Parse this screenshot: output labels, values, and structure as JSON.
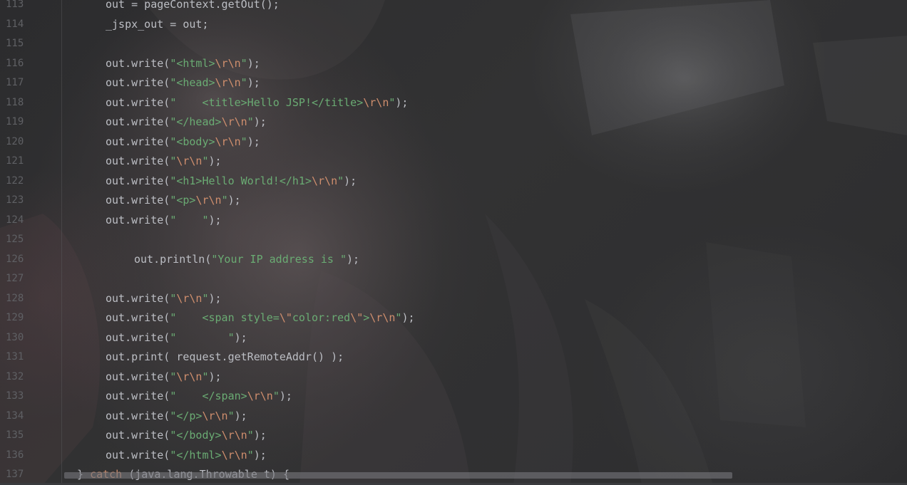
{
  "editor": {
    "theme": {
      "line_number_color": "#5f6064",
      "text_color": "#bcbec4",
      "string_color": "#6aab73",
      "escape_color": "#cf8e6d",
      "keyword_color": "#cf8e6d"
    },
    "lines": [
      {
        "number": "113",
        "indent": 3,
        "tokens": [
          {
            "t": "p",
            "v": "out = pageContext.getOut();"
          }
        ]
      },
      {
        "number": "114",
        "indent": 3,
        "tokens": [
          {
            "t": "p",
            "v": "_jspx_out = out;"
          }
        ]
      },
      {
        "number": "115",
        "indent": 3,
        "tokens": []
      },
      {
        "number": "116",
        "indent": 3,
        "tokens": [
          {
            "t": "p",
            "v": "out.write("
          },
          {
            "t": "s",
            "v": "\"<html>"
          },
          {
            "t": "e",
            "v": "\\r\\n"
          },
          {
            "t": "s",
            "v": "\""
          },
          {
            "t": "p",
            "v": ");"
          }
        ]
      },
      {
        "number": "117",
        "indent": 3,
        "tokens": [
          {
            "t": "p",
            "v": "out.write("
          },
          {
            "t": "s",
            "v": "\"<head>"
          },
          {
            "t": "e",
            "v": "\\r\\n"
          },
          {
            "t": "s",
            "v": "\""
          },
          {
            "t": "p",
            "v": ");"
          }
        ]
      },
      {
        "number": "118",
        "indent": 3,
        "tokens": [
          {
            "t": "p",
            "v": "out.write("
          },
          {
            "t": "s",
            "v": "\"    <title>Hello JSP!</title>"
          },
          {
            "t": "e",
            "v": "\\r\\n"
          },
          {
            "t": "s",
            "v": "\""
          },
          {
            "t": "p",
            "v": ");"
          }
        ]
      },
      {
        "number": "119",
        "indent": 3,
        "tokens": [
          {
            "t": "p",
            "v": "out.write("
          },
          {
            "t": "s",
            "v": "\"</head>"
          },
          {
            "t": "e",
            "v": "\\r\\n"
          },
          {
            "t": "s",
            "v": "\""
          },
          {
            "t": "p",
            "v": ");"
          }
        ]
      },
      {
        "number": "120",
        "indent": 3,
        "tokens": [
          {
            "t": "p",
            "v": "out.write("
          },
          {
            "t": "s",
            "v": "\"<body>"
          },
          {
            "t": "e",
            "v": "\\r\\n"
          },
          {
            "t": "s",
            "v": "\""
          },
          {
            "t": "p",
            "v": ");"
          }
        ]
      },
      {
        "number": "121",
        "indent": 3,
        "tokens": [
          {
            "t": "p",
            "v": "out.write("
          },
          {
            "t": "s",
            "v": "\""
          },
          {
            "t": "e",
            "v": "\\r\\n"
          },
          {
            "t": "s",
            "v": "\""
          },
          {
            "t": "p",
            "v": ");"
          }
        ]
      },
      {
        "number": "122",
        "indent": 3,
        "tokens": [
          {
            "t": "p",
            "v": "out.write("
          },
          {
            "t": "s",
            "v": "\"<h1>Hello World!</h1>"
          },
          {
            "t": "e",
            "v": "\\r\\n"
          },
          {
            "t": "s",
            "v": "\""
          },
          {
            "t": "p",
            "v": ");"
          }
        ]
      },
      {
        "number": "123",
        "indent": 3,
        "tokens": [
          {
            "t": "p",
            "v": "out.write("
          },
          {
            "t": "s",
            "v": "\"<p>"
          },
          {
            "t": "e",
            "v": "\\r\\n"
          },
          {
            "t": "s",
            "v": "\""
          },
          {
            "t": "p",
            "v": ");"
          }
        ]
      },
      {
        "number": "124",
        "indent": 3,
        "tokens": [
          {
            "t": "p",
            "v": "out.write("
          },
          {
            "t": "s",
            "v": "\"    \""
          },
          {
            "t": "p",
            "v": ");"
          }
        ]
      },
      {
        "number": "125",
        "indent": 3,
        "tokens": []
      },
      {
        "number": "126",
        "indent": 4,
        "tokens": [
          {
            "t": "p",
            "v": "out.println("
          },
          {
            "t": "s",
            "v": "\"Your IP address is \""
          },
          {
            "t": "p",
            "v": ");"
          }
        ]
      },
      {
        "number": "127",
        "indent": 3,
        "tokens": []
      },
      {
        "number": "128",
        "indent": 3,
        "tokens": [
          {
            "t": "p",
            "v": "out.write("
          },
          {
            "t": "s",
            "v": "\""
          },
          {
            "t": "e",
            "v": "\\r\\n"
          },
          {
            "t": "s",
            "v": "\""
          },
          {
            "t": "p",
            "v": ");"
          }
        ]
      },
      {
        "number": "129",
        "indent": 3,
        "tokens": [
          {
            "t": "p",
            "v": "out.write("
          },
          {
            "t": "s",
            "v": "\"    <span style="
          },
          {
            "t": "e",
            "v": "\\\""
          },
          {
            "t": "s",
            "v": "color:red"
          },
          {
            "t": "e",
            "v": "\\\""
          },
          {
            "t": "s",
            "v": ">"
          },
          {
            "t": "e",
            "v": "\\r\\n"
          },
          {
            "t": "s",
            "v": "\""
          },
          {
            "t": "p",
            "v": ");"
          }
        ]
      },
      {
        "number": "130",
        "indent": 3,
        "tokens": [
          {
            "t": "p",
            "v": "out.write("
          },
          {
            "t": "s",
            "v": "\"        \""
          },
          {
            "t": "p",
            "v": ");"
          }
        ]
      },
      {
        "number": "131",
        "indent": 3,
        "tokens": [
          {
            "t": "p",
            "v": "out.print( request.getRemoteAddr() );"
          }
        ]
      },
      {
        "number": "132",
        "indent": 3,
        "tokens": [
          {
            "t": "p",
            "v": "out.write("
          },
          {
            "t": "s",
            "v": "\""
          },
          {
            "t": "e",
            "v": "\\r\\n"
          },
          {
            "t": "s",
            "v": "\""
          },
          {
            "t": "p",
            "v": ");"
          }
        ]
      },
      {
        "number": "133",
        "indent": 3,
        "tokens": [
          {
            "t": "p",
            "v": "out.write("
          },
          {
            "t": "s",
            "v": "\"    </span>"
          },
          {
            "t": "e",
            "v": "\\r\\n"
          },
          {
            "t": "s",
            "v": "\""
          },
          {
            "t": "p",
            "v": ");"
          }
        ]
      },
      {
        "number": "134",
        "indent": 3,
        "tokens": [
          {
            "t": "p",
            "v": "out.write("
          },
          {
            "t": "s",
            "v": "\"</p>"
          },
          {
            "t": "e",
            "v": "\\r\\n"
          },
          {
            "t": "s",
            "v": "\""
          },
          {
            "t": "p",
            "v": ");"
          }
        ]
      },
      {
        "number": "135",
        "indent": 3,
        "tokens": [
          {
            "t": "p",
            "v": "out.write("
          },
          {
            "t": "s",
            "v": "\"</body>"
          },
          {
            "t": "e",
            "v": "\\r\\n"
          },
          {
            "t": "s",
            "v": "\""
          },
          {
            "t": "p",
            "v": ");"
          }
        ]
      },
      {
        "number": "136",
        "indent": 3,
        "tokens": [
          {
            "t": "p",
            "v": "out.write("
          },
          {
            "t": "s",
            "v": "\"</html>"
          },
          {
            "t": "e",
            "v": "\\r\\n"
          },
          {
            "t": "s",
            "v": "\""
          },
          {
            "t": "p",
            "v": ");"
          }
        ]
      },
      {
        "number": "137",
        "indent": 2,
        "tokens": [
          {
            "t": "p",
            "v": "} "
          },
          {
            "t": "k",
            "v": "catch"
          },
          {
            "t": "p",
            "v": " (java.lang.Throwable t) {"
          }
        ]
      }
    ]
  }
}
